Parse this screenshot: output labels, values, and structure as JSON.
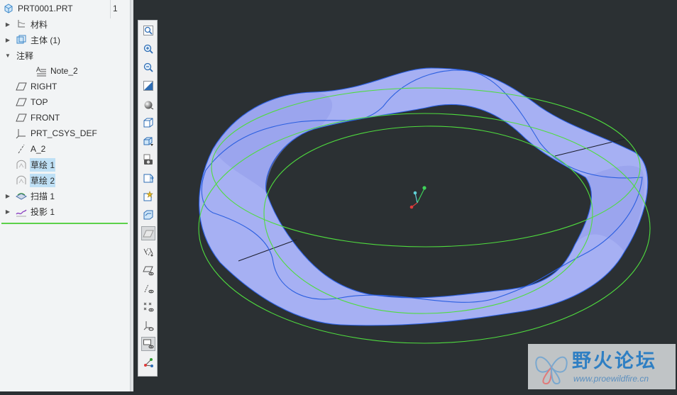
{
  "model_tree": {
    "header_name": "PRT0001.PRT",
    "header_col": "1",
    "items": [
      {
        "label": "材料",
        "icon": "material-icon",
        "expand": "▶",
        "selected": false
      },
      {
        "label": "主体 (1)",
        "icon": "body-icon",
        "expand": "▶",
        "selected": false
      },
      {
        "label": "注释",
        "icon": "",
        "expand": "▼",
        "selected": false
      },
      {
        "label": "Note_2",
        "icon": "note-icon",
        "expand": "",
        "selected": false
      },
      {
        "label": "RIGHT",
        "icon": "datum-plane-icon",
        "expand": "",
        "selected": false
      },
      {
        "label": "TOP",
        "icon": "datum-plane-icon",
        "expand": "",
        "selected": false
      },
      {
        "label": "FRONT",
        "icon": "datum-plane-icon",
        "expand": "",
        "selected": false
      },
      {
        "label": "PRT_CSYS_DEF",
        "icon": "csys-icon",
        "expand": "",
        "selected": false
      },
      {
        "label": "A_2",
        "icon": "axis-icon",
        "expand": "",
        "selected": false
      },
      {
        "label": "草绘 1",
        "icon": "sketch-icon",
        "expand": "",
        "selected": true
      },
      {
        "label": "草绘 2",
        "icon": "sketch-icon",
        "expand": "",
        "selected": true
      },
      {
        "label": "扫描 1",
        "icon": "sweep-icon",
        "expand": "▶",
        "selected": false
      },
      {
        "label": "投影 1",
        "icon": "projection-icon",
        "expand": "▶",
        "selected": false
      }
    ]
  },
  "toolbar": {
    "buttons": [
      {
        "name": "refit-button",
        "icon": "refit-icon"
      },
      {
        "name": "zoom-in-button",
        "icon": "zoom-in-icon"
      },
      {
        "name": "zoom-out-button",
        "icon": "zoom-out-icon"
      },
      {
        "name": "repaint-button",
        "icon": "repaint-icon"
      },
      {
        "name": "display-style-button",
        "icon": "shading-icon"
      },
      {
        "name": "saved-orientations-button",
        "icon": "saved-views-icon"
      },
      {
        "name": "view-manager-button",
        "icon": "view-manager-icon"
      },
      {
        "name": "perspective-button",
        "icon": "camera-icon"
      },
      {
        "name": "section-button",
        "icon": "section-icon"
      },
      {
        "name": "spin-center-button",
        "icon": "spin-center-icon"
      },
      {
        "name": "annotation-display-button",
        "icon": "annotation-display-icon"
      },
      {
        "name": "plane-display-button",
        "icon": "plane-display-icon",
        "active": true
      },
      {
        "name": "axis-display-button",
        "icon": "axis-display-icon"
      },
      {
        "name": "plane-tag-display-button",
        "icon": "plane-tag-icon"
      },
      {
        "name": "axis-tag-display-button",
        "icon": "axis-tag-icon"
      },
      {
        "name": "point-display-button",
        "icon": "point-display-icon"
      },
      {
        "name": "csys-display-button",
        "icon": "csys-display-icon"
      },
      {
        "name": "view-display-button",
        "icon": "view-display-icon",
        "active": true
      },
      {
        "name": "orient-button",
        "icon": "orient-icon"
      }
    ]
  },
  "watermark": {
    "title": "野火论坛",
    "url": "www.proewildfire.cn"
  },
  "colors": {
    "viewport_bg": "#2b3033",
    "surface": "#a9b3f4",
    "edge_blue": "#2b5fe0",
    "curve_green": "#4fdc3e"
  }
}
